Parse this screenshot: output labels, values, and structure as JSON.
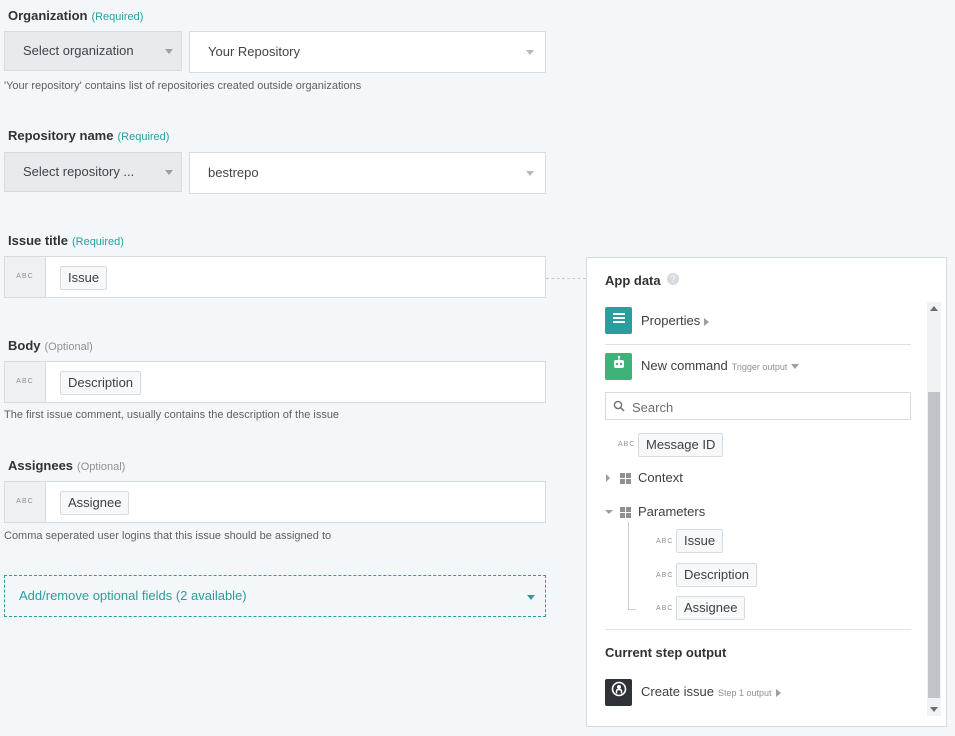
{
  "organization": {
    "label": "Organization",
    "tag": "(Required)",
    "select_label": "Select organization",
    "value": "Your Repository",
    "help": "'Your repository' contains list of repositories created outside organizations"
  },
  "repository": {
    "label": "Repository name",
    "tag": "(Required)",
    "select_label": "Select repository ...",
    "value": "bestrepo"
  },
  "issue_title": {
    "label": "Issue title",
    "tag": "(Required)",
    "abc": "ABC",
    "token": "Issue"
  },
  "body": {
    "label": "Body",
    "tag": "(Optional)",
    "abc": "ABC",
    "token": "Description",
    "help": "The first issue comment, usually contains the description of the issue"
  },
  "assignees": {
    "label": "Assignees",
    "tag": "(Optional)",
    "abc": "ABC",
    "token": "Assignee",
    "help": "Comma seperated user logins that this issue should be assigned to"
  },
  "optional_fields": {
    "label": "Add/remove optional fields (2 available)"
  },
  "app_data": {
    "title": "App data",
    "help_glyph": "?",
    "properties": {
      "label": "Properties"
    },
    "new_command": {
      "label": "New command",
      "sub": "Trigger output"
    },
    "search": {
      "placeholder": "Search"
    },
    "items": {
      "message_id": "Message ID",
      "context": "Context",
      "parameters": "Parameters",
      "params": [
        "Issue",
        "Description",
        "Assignee"
      ],
      "abc": "ABC"
    },
    "current_step": {
      "title": "Current step output",
      "label": "Create issue",
      "sub": "Step 1 output"
    }
  },
  "colors": {
    "accent": "#2a9d9f",
    "properties_icon": "#2a9d9f",
    "command_icon": "#3db37a",
    "github_icon": "#2f3236"
  }
}
